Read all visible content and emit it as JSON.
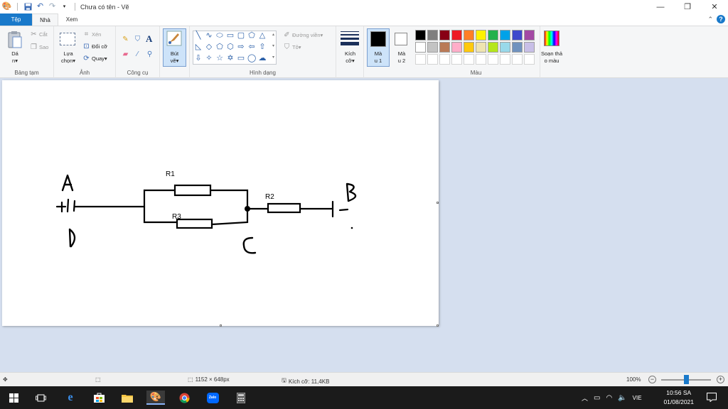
{
  "window": {
    "title": "Chưa có tên - Vẽ",
    "icons": {
      "app": "paint-palette-icon",
      "save": "save-icon",
      "undo": "undo-icon",
      "redo": "redo-icon"
    }
  },
  "tabs": {
    "file": "Tệp",
    "home": "Nhà",
    "view": "Xem"
  },
  "ribbon": {
    "clipboard": {
      "label": "Bảng tạm",
      "paste": "Dá\nn▾",
      "cut": "Cắt",
      "copy": "Sao"
    },
    "image": {
      "label": "Ảnh",
      "select": "Lựa\nchọn▾",
      "crop": "Xén",
      "resize": "Đổi cỡ",
      "rotate": "Quay▾"
    },
    "tools": {
      "label": "Công cụ"
    },
    "brushes": {
      "label": "Bút\nvẽ▾"
    },
    "shapes": {
      "label": "Hình dạng",
      "outline": "Đường viền▾",
      "fill": "Tô▾"
    },
    "size": {
      "label": "Kích\ncỡ▾"
    },
    "color1": {
      "label": "Mà\nu 1",
      "value": "#000000"
    },
    "color2": {
      "label": "Mà\nu 2",
      "value": "#ffffff"
    },
    "colors": {
      "label": "Màu",
      "edit": "Soạn thả\no màu",
      "row1": [
        "#000000",
        "#7f7f7f",
        "#880015",
        "#ed1c24",
        "#ff7f27",
        "#fff200",
        "#22b14c",
        "#00a2e8",
        "#3f48cc",
        "#a349a4"
      ],
      "row2": [
        "#ffffff",
        "#c3c3c3",
        "#b97a57",
        "#ffaec9",
        "#ffc90e",
        "#efe4b0",
        "#b5e61d",
        "#99d9ea",
        "#7092be",
        "#c8bfe7"
      ]
    }
  },
  "drawing": {
    "labels": {
      "A": "A",
      "B": "B",
      "C": "C",
      "D": "D",
      "R1": "R1",
      "R2": "R2",
      "R3": "R3",
      "plus": "+",
      "minus": "−"
    }
  },
  "statusbar": {
    "dimensions": "1152 × 648px",
    "size": "Kích cỡ: 11,4KB",
    "zoom": "100%"
  },
  "taskbar": {
    "language": "VIE",
    "time": "10:56 SA",
    "date": "01/08/2021",
    "apps": [
      "windows-start-icon",
      "task-view-icon",
      "edge-icon",
      "store-icon",
      "file-explorer-icon",
      "paint-icon",
      "chrome-icon",
      "zalo-icon",
      "calculator-icon"
    ]
  }
}
